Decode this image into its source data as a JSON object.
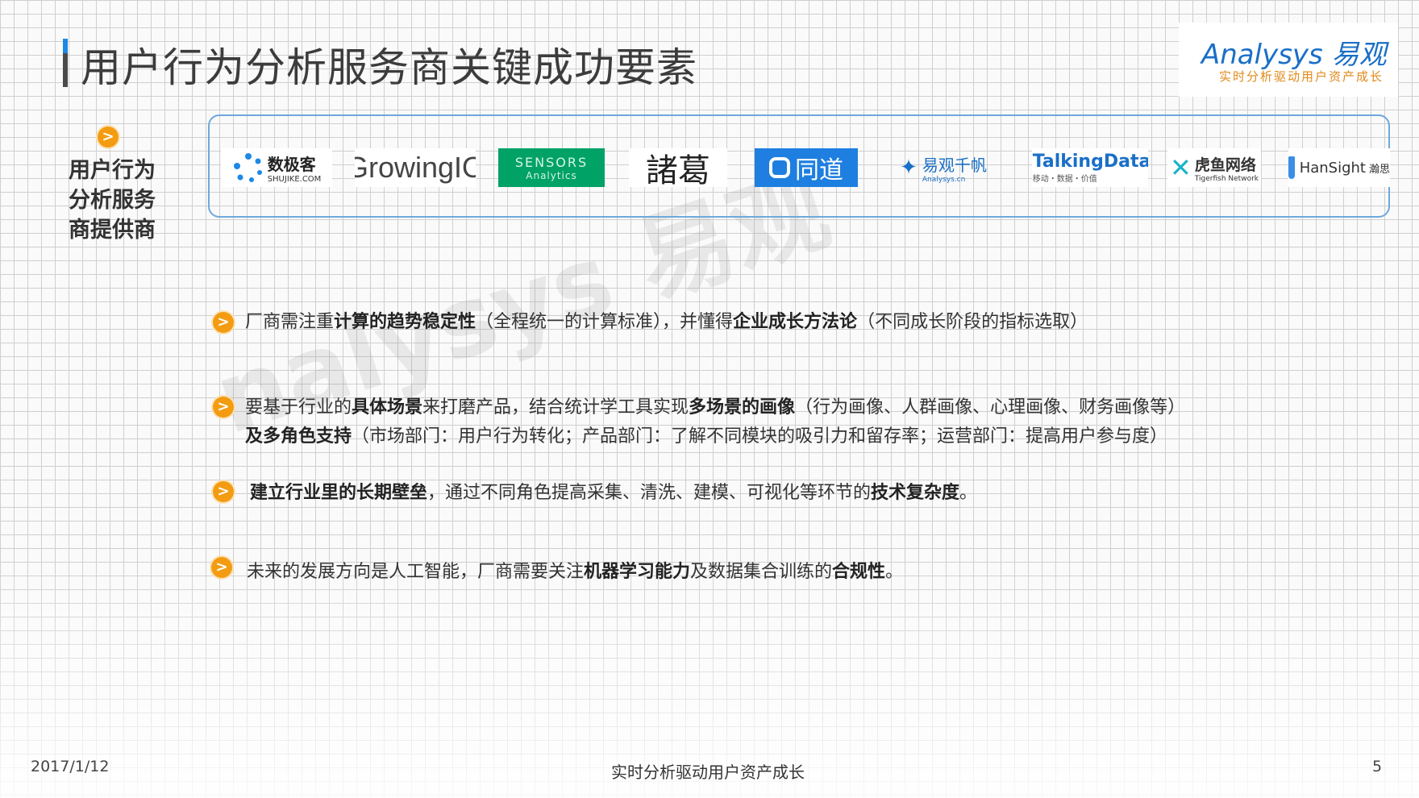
{
  "header": {
    "title": "用户行为分析服务商关键成功要素"
  },
  "brand": {
    "name": "Analysys 易观",
    "slogan": "实时分析驱动用户资产成长"
  },
  "side_label": "用户行为分析服务商提供商",
  "providers": [
    {
      "name": "数极客",
      "sub": "SHUJIKE.COM"
    },
    {
      "name": "GrowingIO"
    },
    {
      "name": "SENSORS",
      "sub": "Analytics"
    },
    {
      "name": "諸葛"
    },
    {
      "name": "同道"
    },
    {
      "name": "易观千帆",
      "sub": "Analysys.cn"
    },
    {
      "name": "TalkingData",
      "sub": "移动・数据・价值"
    },
    {
      "name": "虎鱼网络",
      "sub": "Tigerfish Network"
    },
    {
      "name": "HanSight",
      "sub": "瀚思"
    }
  ],
  "points": [
    {
      "t1": "厂商需注重",
      "b1": "计算的趋势稳定性",
      "t2": "（全程统一的计算标准），并懂得",
      "b2": "企业成长方法论",
      "t3": "（不同成长阶段的指标选取）"
    },
    {
      "t1": "要基于行业的",
      "b1": "具体场景",
      "t2": "来打磨产品，结合统计学工具实现",
      "b2": "多场景的画像",
      "t3": "（行为画像、人群画像、心理画像、财务画像等）",
      "line2_b": "及多角色支持",
      "line2_t": "（市场部门：用户行为转化；产品部门：了解不同模块的吸引力和留存率；运营部门：提高用户参与度）"
    },
    {
      "b1": "建立行业里的长期壁垒",
      "t2": "，通过不同角色提高采集、清洗、建模、可视化等环节的",
      "b2": "技术复杂度",
      "t3": "。"
    },
    {
      "t1": "未来的发展方向是人工智能，厂商需要关注",
      "b1": "机器学习能力",
      "t2": "及数据集合训练的",
      "b2": "合规性",
      "t3": "。"
    }
  ],
  "footer": {
    "date": "2017/1/12",
    "slogan": "实时分析驱动用户资产成长",
    "page": "5"
  },
  "colors": {
    "accent": "#f39c12",
    "brand_blue": "#1a6fc7",
    "panel_border": "#6fa8dc"
  }
}
